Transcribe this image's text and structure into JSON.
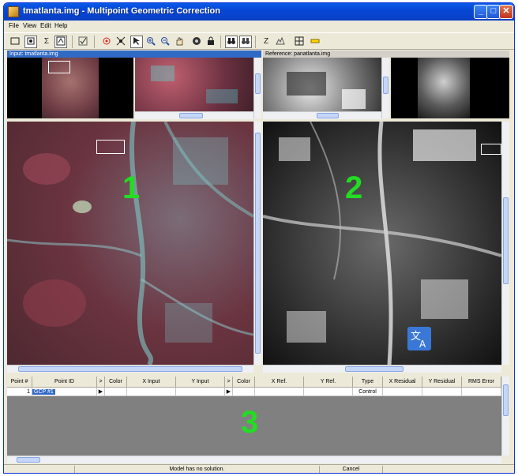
{
  "window": {
    "title": "tmatlanta.img - Multipoint Geometric Correction",
    "minimize_glyph": "_",
    "maximize_glyph": "□",
    "close_glyph": "✕"
  },
  "menu": [
    "File",
    "View",
    "Edit",
    "Help"
  ],
  "toolbar": {
    "sigma_label": "Σ",
    "z_label": "Z"
  },
  "input_pane": {
    "header": "Input: tmatlanta.img",
    "label": "1"
  },
  "reference_pane": {
    "header": "Reference: panatlanta.img",
    "label": "2"
  },
  "grid": {
    "label": "3",
    "columns": [
      "Point #",
      "Point ID",
      ">",
      "Color",
      "X Input",
      "Y Input",
      ">",
      "Color",
      "X Ref.",
      "Y Ref.",
      "Type",
      "X Residual",
      "Y Residual",
      "RMS Error"
    ],
    "rows": [
      {
        "point_num": "1",
        "point_id": "GCP #1",
        "marker": "▶",
        "marker2": "▶",
        "type": "Control"
      }
    ]
  },
  "status": {
    "message": "Model has no solution.",
    "cancel": "Cancel"
  },
  "colors": {
    "titlebar": "#0a5ae8",
    "active_header": "#316ac5",
    "label_green": "#22dd22",
    "grid_background": "#808080"
  }
}
